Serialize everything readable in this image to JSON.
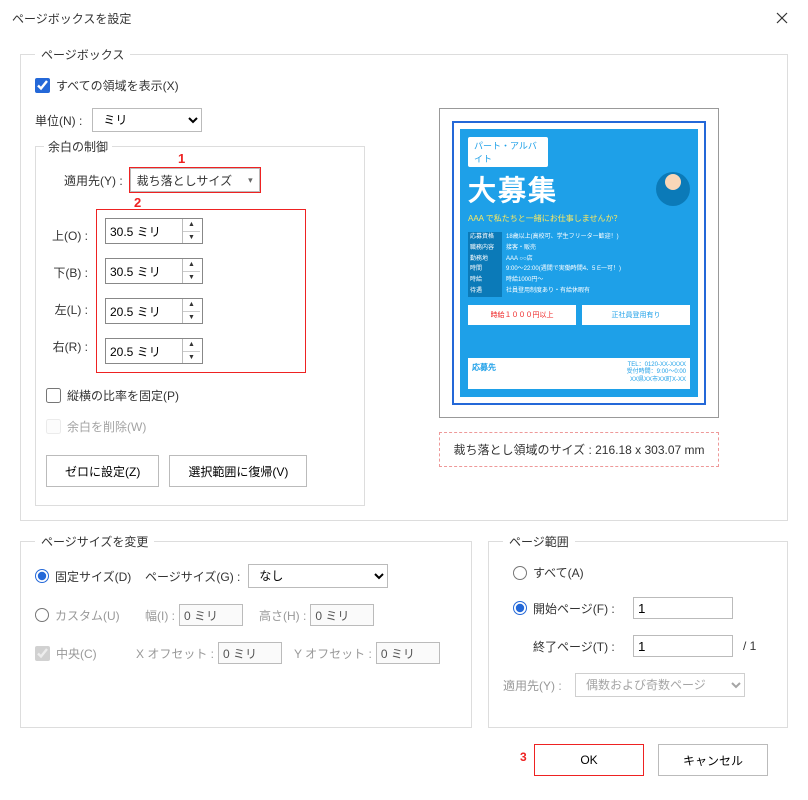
{
  "titlebar": {
    "title": "ページボックスを設定"
  },
  "pagebox": {
    "legend": "ページボックス",
    "show_all_label": "すべての領域を表示(X)",
    "unit_label": "単位(N) :",
    "unit_value": "ミリ",
    "margin": {
      "title": "余白の制御",
      "apply_label": "適用先(Y) :",
      "apply_value": "裁ち落としサイズ",
      "top_label": "上(O) :",
      "bottom_label": "下(B) :",
      "left_label": "左(L) :",
      "right_label": "右(R) :",
      "top_value": "30.5 ミリ",
      "bottom_value": "30.5 ミリ",
      "left_value": "20.5 ミリ",
      "right_value": "20.5 ミリ",
      "lock_ratio_label": "縦横の比率を固定(P)",
      "remove_margin_label": "余白を削除(W)",
      "zero_btn": "ゼロに設定(Z)",
      "revert_btn": "選択範囲に復帰(V)"
    },
    "size_info": "裁ち落とし領域のサイズ : 216.18 x 303.07 mm"
  },
  "flyer": {
    "head": "パート・アルバイト",
    "big": "大募集",
    "sub": "AAA で私たちと一緒にお仕事しませんか？",
    "rows": [
      {
        "l": "応募資格",
        "v": "18歳以上(高校可、学生フリーター歓迎！)"
      },
      {
        "l": "職務内容",
        "v": "接客・販売"
      },
      {
        "l": "勤務地",
        "v": "AAA ○○店"
      },
      {
        "l": "時間",
        "v": "9:00～22:00(週間で実働時間4、5 E一可！)"
      },
      {
        "l": "時給",
        "v": "時給1000円～"
      },
      {
        "l": "待遇",
        "v": "社員登用制度あり・有給休暇有"
      }
    ],
    "box1": "時給１０００円以上",
    "box2": "正社員登用有り",
    "bot_l": "応募先",
    "bot_r1": "TEL：0120-XX-XXXX",
    "bot_r2": "受付時間：9:00～0:00",
    "bot_r3": "XX県XX市XX町X-XX"
  },
  "pagesize": {
    "legend": "ページサイズを変更",
    "fixed_label": "固定サイズ(D)",
    "pagesize_label": "ページサイズ(G) :",
    "pagesize_value": "なし",
    "custom_label": "カスタム(U)",
    "width_label": "幅(I) :",
    "width_value": "0 ミリ",
    "height_label": "高さ(H) :",
    "height_value": "0 ミリ",
    "center_label": "中央(C)",
    "xoff_label": "X オフセット :",
    "xoff_value": "0 ミリ",
    "yoff_label": "Y オフセット :",
    "yoff_value": "0 ミリ"
  },
  "pagerange": {
    "legend": "ページ範囲",
    "all_label": "すべて(A)",
    "start_label": "開始ページ(F) :",
    "start_value": "1",
    "end_label": "終了ページ(T) :",
    "end_value": "1",
    "end_total": "/ 1",
    "apply_label": "適用先(Y) :",
    "apply_value": "偶数および奇数ページ"
  },
  "footer": {
    "ok": "OK",
    "cancel": "キャンセル"
  },
  "annotations": {
    "n1": "1",
    "n2": "2",
    "n3": "3"
  }
}
